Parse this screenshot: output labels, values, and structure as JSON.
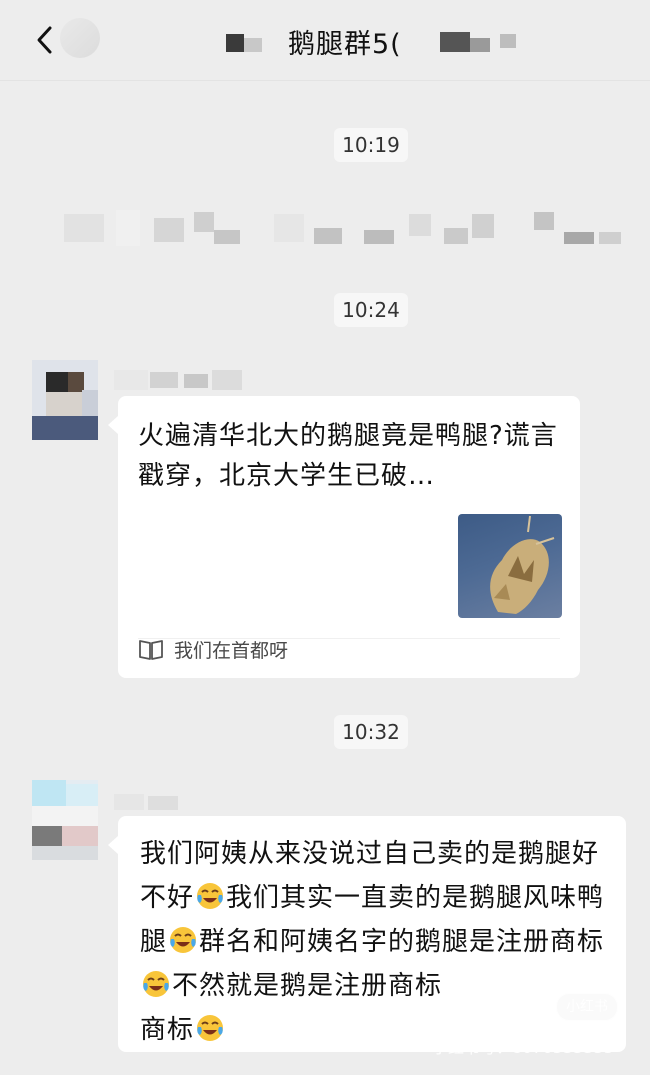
{
  "header": {
    "title": "鹅腿群5(",
    "back_icon": "back-chevron-icon"
  },
  "timestamps": [
    "10:19",
    "10:24",
    "10:32"
  ],
  "messages": {
    "link_card": {
      "title": "火遍清华北大的鹅腿竟是鸭腿?谎言戳穿，北京大学生已破…",
      "source": "我们在首都呀",
      "source_icon": "book-icon"
    },
    "text_message": {
      "parts": [
        "我们阿姨从来没说过自己卖的是鹅腿好不好",
        "我们其实一直卖的是鹅腿风味鸭腿",
        "群名和阿姨名字的鹅腿是注册商标",
        "不然就是鹅是注册商标",
        "商标"
      ],
      "emoji": "face-with-tears-of-joy-icon"
    }
  },
  "watermark": {
    "logo": "小红书",
    "id": "小红书号：8070535355"
  },
  "colors": {
    "background": "#ededed",
    "bubble": "#ffffff",
    "timestamp_bg": "#f7f7f7"
  }
}
